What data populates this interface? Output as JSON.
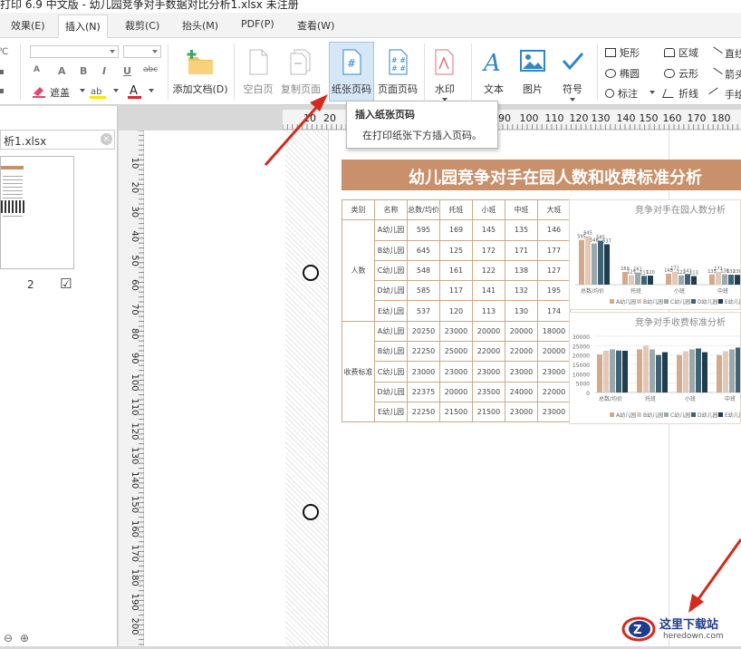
{
  "window": {
    "title": "打印 6.9 中文版 - 幼儿园竞争对手数据对比分析1.xlsx 未注册"
  },
  "tabs": [
    {
      "label": "效果(E)"
    },
    {
      "label": "插入(N)"
    },
    {
      "label": "裁剪(C)"
    },
    {
      "label": "抬头(M)"
    },
    {
      "label": "PDF(P)"
    },
    {
      "label": "查看(W)"
    }
  ],
  "ribbon": {
    "left_labels": {
      "cover": "遮盖"
    },
    "format_glyphs": [
      "A",
      "A",
      "B",
      "I",
      "U",
      "abc"
    ],
    "buttons": {
      "add_doc": "添加文档(D)",
      "blank_page": "空白页",
      "copy_page": "复制页面",
      "paper_page_number": "纸张页码",
      "page_number": "页面页码",
      "watermark": "水印",
      "text": "文本",
      "image": "图片",
      "symbol": "符号"
    },
    "shapes": {
      "rect": "矩形",
      "ellipse": "椭圆",
      "annotation": "标注",
      "region": "区域",
      "cloud": "云形",
      "polyline": "折线",
      "line": "直线",
      "arrow": "箭头",
      "freehand": "手绘"
    }
  },
  "left_panel": {
    "filename": "析1.xlsx",
    "page_number": "2",
    "checkbox": "☑"
  },
  "ruler": {
    "h": [
      "10",
      "20",
      "90",
      "100",
      "110",
      "120",
      "130",
      "140",
      "150",
      "160",
      "170",
      "180"
    ],
    "v": [
      "10",
      "20",
      "30",
      "40",
      "50",
      "60",
      "70",
      "80",
      "90",
      "100",
      "110",
      "120",
      "130",
      "140",
      "150",
      "160",
      "170",
      "180",
      "190",
      "200"
    ]
  },
  "tooltip": {
    "title": "插入纸张页码",
    "desc": "在打印纸张下方插入页码。"
  },
  "sheet": {
    "title": "幼儿园竞争对手在园人数和收费标准分析",
    "headers": [
      "类别",
      "名称",
      "总数/均价",
      "托班",
      "小班",
      "中班",
      "大班"
    ],
    "groups": [
      {
        "name": "人数",
        "rows": [
          [
            "A幼儿园",
            "595",
            "169",
            "145",
            "135",
            "146"
          ],
          [
            "B幼儿园",
            "645",
            "125",
            "172",
            "171",
            "177"
          ],
          [
            "C幼儿园",
            "548",
            "161",
            "122",
            "138",
            "127"
          ],
          [
            "D幼儿园",
            "585",
            "117",
            "141",
            "132",
            "195"
          ],
          [
            "E幼儿园",
            "537",
            "120",
            "113",
            "130",
            "174"
          ]
        ]
      },
      {
        "name": "收费标准",
        "rows": [
          [
            "A幼儿园",
            "20250",
            "23000",
            "20000",
            "20000",
            "18000"
          ],
          [
            "B幼儿园",
            "22250",
            "25000",
            "22000",
            "22000",
            "20000"
          ],
          [
            "C幼儿园",
            "23000",
            "23000",
            "23000",
            "23000",
            "23000"
          ],
          [
            "D幼儿园",
            "22375",
            "20000",
            "23500",
            "24000",
            "22000"
          ],
          [
            "E幼儿园",
            "22250",
            "21500",
            "21500",
            "23000",
            "23000"
          ]
        ]
      }
    ]
  },
  "chart_data": [
    {
      "type": "bar",
      "title": "竞争对手在园人数分析",
      "categories": [
        "总数/均价",
        "托班",
        "小班",
        "中班"
      ],
      "series": [
        {
          "name": "A幼儿园",
          "values": [
            595,
            169,
            145,
            135
          ]
        },
        {
          "name": "B幼儿园",
          "values": [
            645,
            125,
            172,
            171
          ]
        },
        {
          "name": "C幼儿园",
          "values": [
            548,
            161,
            122,
            138
          ]
        },
        {
          "name": "D幼儿园",
          "values": [
            585,
            117,
            141,
            132
          ]
        },
        {
          "name": "E幼儿园",
          "values": [
            537,
            120,
            113,
            130
          ]
        }
      ],
      "ylim": [
        0,
        700
      ],
      "legend": "bottom",
      "colors": [
        "#d4aa8c",
        "#e2c8b6",
        "#9aa9ae",
        "#3f6274",
        "#1f3d4e"
      ]
    },
    {
      "type": "bar",
      "title": "竞争对手收费标准分析",
      "categories": [
        "总数/均价",
        "托班",
        "小班",
        "中班"
      ],
      "series": [
        {
          "name": "A幼儿园",
          "values": [
            20250,
            23000,
            20000,
            20000
          ]
        },
        {
          "name": "B幼儿园",
          "values": [
            22250,
            25000,
            22000,
            22000
          ]
        },
        {
          "name": "C幼儿园",
          "values": [
            23000,
            23000,
            23000,
            23000
          ]
        },
        {
          "name": "D幼儿园",
          "values": [
            22375,
            20000,
            23500,
            24000
          ]
        },
        {
          "name": "E幼儿园",
          "values": [
            22250,
            21500,
            21500,
            23000
          ]
        }
      ],
      "yticks": [
        "30000",
        "25000",
        "20000",
        "15000",
        "10000",
        "5000",
        "0"
      ],
      "ylim": [
        0,
        30000
      ],
      "legend": "bottom",
      "colors": [
        "#d4aa8c",
        "#e2c8b6",
        "#9aa9ae",
        "#3f6274",
        "#1f3d4e"
      ]
    }
  ],
  "watermark": {
    "name": "这里下载站",
    "url": "heredown.com"
  },
  "colors": {
    "accent": "#c8916b",
    "arrow": "#d42a1e",
    "selected_button": "#d6e8f8"
  }
}
